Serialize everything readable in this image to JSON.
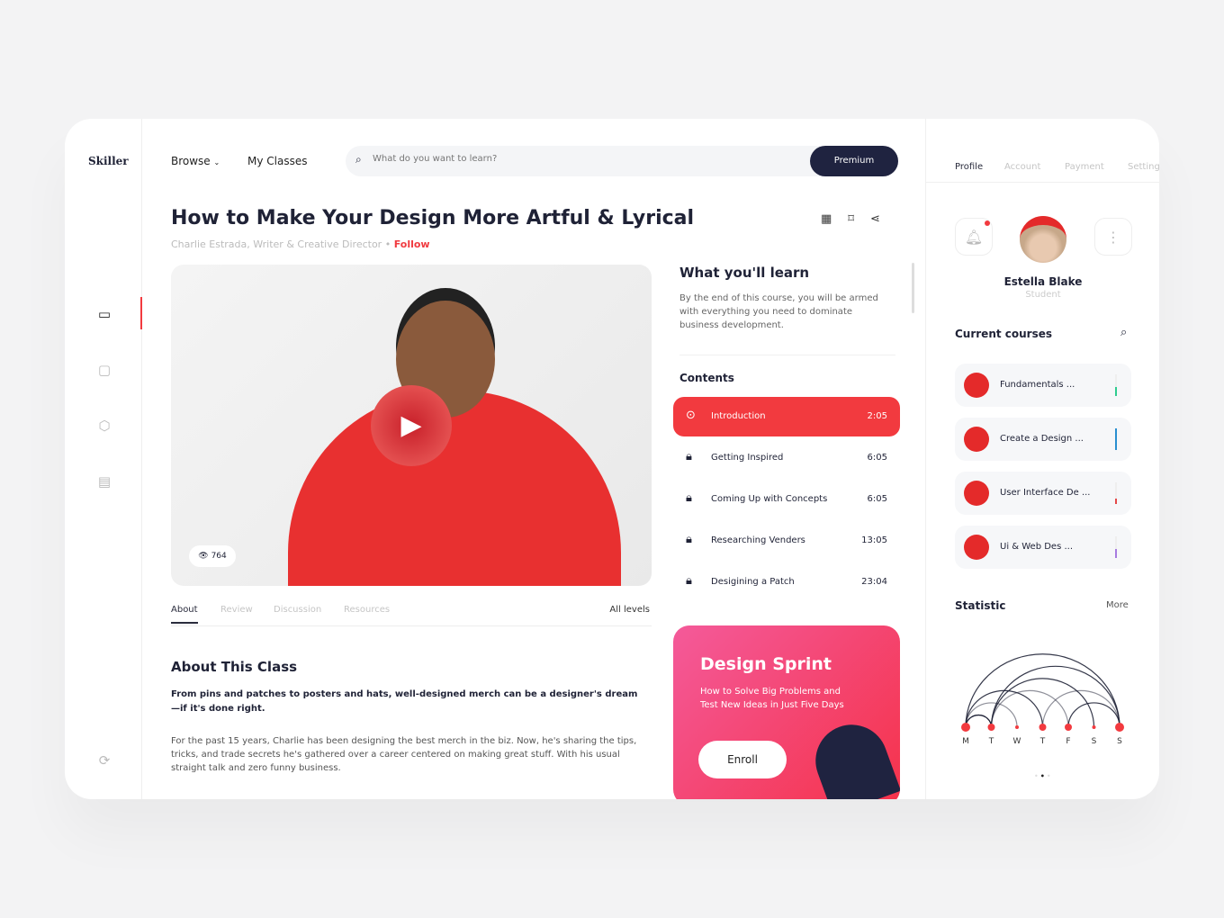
{
  "app": {
    "logo": "Skiller"
  },
  "sidebar": {
    "icons": [
      "book-icon",
      "chat-icon",
      "settings-icon",
      "stats-icon",
      "logout-icon"
    ]
  },
  "nav": {
    "browse": "Browse",
    "my_classes": "My Classes"
  },
  "search": {
    "placeholder": "What do you want to learn?",
    "premium": "Premium"
  },
  "course": {
    "title": "How to Make Your Design More Artful & Lyrical",
    "author": "Charlie Estrada, Writer & Creative Director",
    "follow": "Follow",
    "views": "764"
  },
  "tabs": [
    {
      "label": "About"
    },
    {
      "label": "Review"
    },
    {
      "label": "Discussion"
    },
    {
      "label": "Resources"
    }
  ],
  "level": "All levels",
  "about": {
    "heading": "About This Class",
    "lead": "From pins and patches to posters and hats, well-designed merch can be a designer's dream—if it's done right.",
    "body": "For the past 15 years, Charlie has been designing the best merch in the biz. Now, he's sharing the tips, tricks, and trade secrets he's gathered over a career centered on making great stuff. With his usual straight talk and zero funny business."
  },
  "learn": {
    "heading": "What you'll learn",
    "text": "By the end of this course, you will be armed with everything you need to dominate business development."
  },
  "contents": {
    "heading": "Contents",
    "lessons": [
      {
        "title": "Introduction",
        "duration": "2:05",
        "active": true
      },
      {
        "title": "Getting Inspired",
        "duration": "6:05",
        "locked": true
      },
      {
        "title": "Coming Up with Concepts",
        "duration": "6:05",
        "locked": true
      },
      {
        "title": "Researching Venders",
        "duration": "13:05",
        "locked": true
      },
      {
        "title": "Desigining a Patch",
        "duration": "23:04",
        "locked": true
      }
    ]
  },
  "promo": {
    "title": "Design Sprint",
    "text": "How to Solve Big Problems and Test New Ideas in Just Five Days",
    "button": "Enroll"
  },
  "profile": {
    "tabs": [
      "Profile",
      "Account",
      "Payment",
      "Setting"
    ],
    "name": "Estella Blake",
    "role": "Student",
    "has_notification": true
  },
  "courses": {
    "heading": "Current courses",
    "items": [
      {
        "name": "Fundamentals ...",
        "progress": 40,
        "color": "#2ecc8f"
      },
      {
        "name": "Create a Design ...",
        "progress": 100,
        "color": "#2a8fd0"
      },
      {
        "name": "User Interface De ...",
        "progress": 25,
        "color": "#e54848"
      },
      {
        "name": "Ui & Web Des ...",
        "progress": 40,
        "color": "#a77be0"
      }
    ]
  },
  "statistic": {
    "heading": "Statistic",
    "more": "More",
    "days": [
      "M",
      "T",
      "W",
      "T",
      "F",
      "S",
      "S"
    ],
    "arcs": [
      [
        0,
        1
      ],
      [
        0,
        2
      ],
      [
        0,
        3
      ],
      [
        0,
        6
      ],
      [
        1,
        4
      ],
      [
        1,
        5
      ],
      [
        1,
        6
      ],
      [
        3,
        6
      ],
      [
        4,
        6
      ],
      [
        0,
        1
      ]
    ],
    "colors": {
      "arc": "#1f2236",
      "dot": "#f23a3f"
    }
  }
}
